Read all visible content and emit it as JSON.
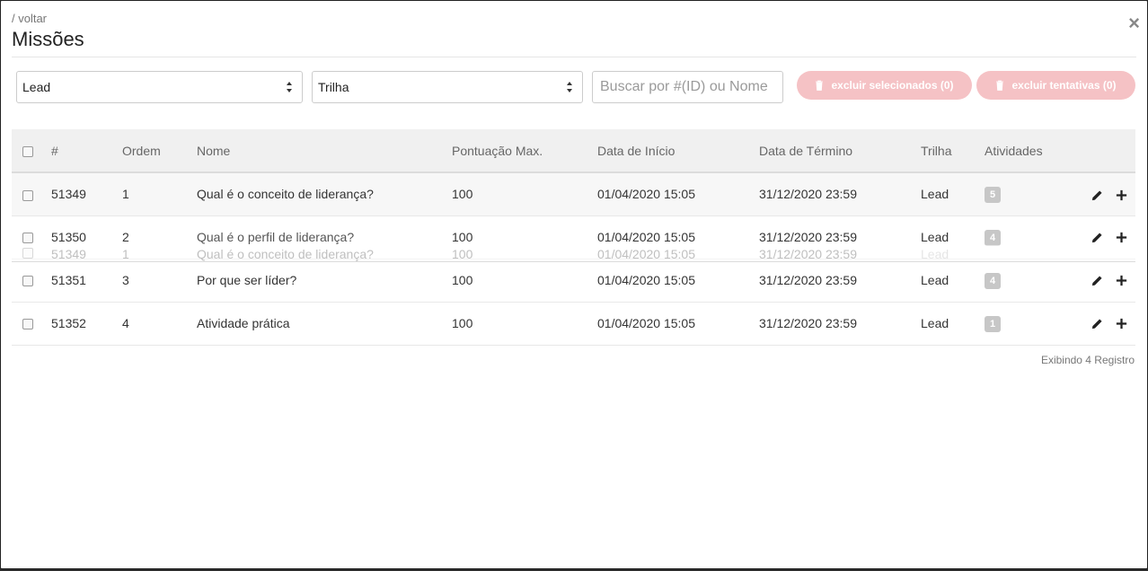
{
  "nav": {
    "back_label": "/ voltar",
    "title": "Missões"
  },
  "filters": {
    "lead_value": "Lead",
    "trilha_value": "Trilha",
    "search_placeholder": "Buscar por #(ID) ou Nome"
  },
  "actions": {
    "delete_selected_label": "excluir selecionados (0)",
    "delete_attempts_label": "excluir tentativas (0)"
  },
  "table": {
    "columns": [
      "#",
      "Ordem",
      "Nome",
      "Pontuação Max.",
      "Data de Início",
      "Data de Término",
      "Trilha",
      "Atividades"
    ],
    "rows": [
      {
        "id": "51349",
        "ordem": "1",
        "nome": "Qual é o conceito de liderança?",
        "pontuacao": "100",
        "inicio": "01/04/2020 15:05",
        "termino": "31/12/2020 23:59",
        "trilha": "Lead",
        "atividades": "5"
      },
      {
        "id": "51350",
        "ordem": "2",
        "nome": "Qual é o perfil de liderança?",
        "pontuacao": "100",
        "inicio": "01/04/2020 15:05",
        "termino": "31/12/2020 23:59",
        "trilha": "Lead",
        "atividades": "4"
      },
      {
        "id": "51351",
        "ordem": "3",
        "nome": "Por que ser líder?",
        "pontuacao": "100",
        "inicio": "01/04/2020 15:05",
        "termino": "31/12/2020 23:59",
        "trilha": "Lead",
        "atividades": "4"
      },
      {
        "id": "51352",
        "ordem": "4",
        "nome": "Atividade prática",
        "pontuacao": "100",
        "inicio": "01/04/2020 15:05",
        "termino": "31/12/2020 23:59",
        "trilha": "Lead",
        "atividades": "1"
      }
    ],
    "drag_ghost": {
      "id": "51349",
      "ordem": "1",
      "nome": "Qual é o conceito de liderança?",
      "pontuacao": "100",
      "inicio": "01/04/2020 15:05",
      "termino": "31/12/2020 23:59",
      "trilha": "Lead"
    }
  },
  "footer": {
    "count_text": "Exibindo 4 Registro"
  },
  "colors": {
    "danger_light": "#f5c2c5",
    "badge": "#c7c7c7",
    "header_bg": "#f0f0f0"
  }
}
